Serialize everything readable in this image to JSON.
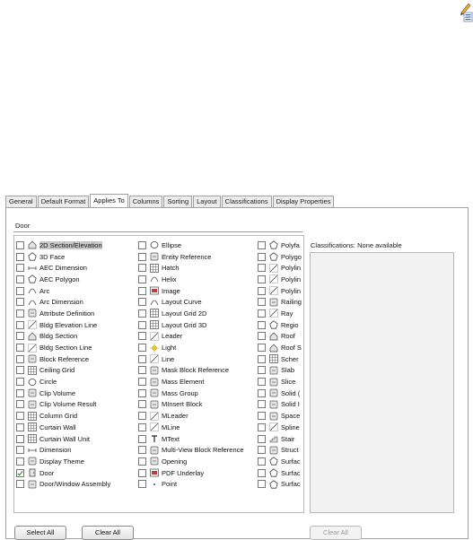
{
  "tabs": [
    {
      "label": "General"
    },
    {
      "label": "Default Format"
    },
    {
      "label": "Applies To",
      "active": true
    },
    {
      "label": "Columns"
    },
    {
      "label": "Sorting"
    },
    {
      "label": "Layout"
    },
    {
      "label": "Classifications"
    },
    {
      "label": "Display Properties"
    }
  ],
  "filter": {
    "value": "Door"
  },
  "classifications": {
    "label": "Classifications: None available"
  },
  "buttons": {
    "select_all": "Select All",
    "clear_all": "Clear All",
    "clear_all_right": "Clear All"
  },
  "columns": [
    [
      {
        "label": "2D Section/Elevation",
        "icon": "section-elevation-icon",
        "selected": true
      },
      {
        "label": "3D Face",
        "icon": "face-icon"
      },
      {
        "label": "AEC Dimension",
        "icon": "dimension-icon"
      },
      {
        "label": "AEC Polygon",
        "icon": "polygon-icon"
      },
      {
        "label": "Arc",
        "icon": "arc-icon"
      },
      {
        "label": "Arc Dimension",
        "icon": "arc-dimension-icon"
      },
      {
        "label": "Attribute Definition",
        "icon": "attribute-icon"
      },
      {
        "label": "Bldg Elevation Line",
        "icon": "elevation-line-icon"
      },
      {
        "label": "Bldg Section",
        "icon": "bldg-section-icon"
      },
      {
        "label": "Bldg Section Line",
        "icon": "section-line-icon"
      },
      {
        "label": "Block Reference",
        "icon": "block-icon"
      },
      {
        "label": "Ceiling Grid",
        "icon": "ceiling-grid-icon"
      },
      {
        "label": "Circle",
        "icon": "circle-icon"
      },
      {
        "label": "Clip Volume",
        "icon": "clip-volume-icon"
      },
      {
        "label": "Clip Volume Result",
        "icon": "clip-result-icon"
      },
      {
        "label": "Column Grid",
        "icon": "column-grid-icon"
      },
      {
        "label": "Curtain Wall",
        "icon": "curtain-wall-icon"
      },
      {
        "label": "Curtain Wall Unit",
        "icon": "curtain-unit-icon"
      },
      {
        "label": "Dimension",
        "icon": "dimension-icon"
      },
      {
        "label": "Display Theme",
        "icon": "theme-icon"
      },
      {
        "label": "Door",
        "icon": "door-icon",
        "checked": true
      },
      {
        "label": "Door/Window Assembly",
        "icon": "assembly-icon"
      }
    ],
    [
      {
        "label": "Ellipse",
        "icon": "ellipse-icon"
      },
      {
        "label": "Entity Reference",
        "icon": "entity-icon"
      },
      {
        "label": "Hatch",
        "icon": "hatch-icon"
      },
      {
        "label": "Helix",
        "icon": "helix-icon"
      },
      {
        "label": "Image",
        "icon": "image-icon"
      },
      {
        "label": "Layout Curve",
        "icon": "curve-icon"
      },
      {
        "label": "Layout Grid 2D",
        "icon": "grid2d-icon"
      },
      {
        "label": "Layout Grid 3D",
        "icon": "grid3d-icon"
      },
      {
        "label": "Leader",
        "icon": "leader-icon"
      },
      {
        "label": "Light",
        "icon": "light-icon"
      },
      {
        "label": "Line",
        "icon": "line-icon"
      },
      {
        "label": "Mask Block Reference",
        "icon": "mask-block-icon"
      },
      {
        "label": "Mass Element",
        "icon": "mass-element-icon"
      },
      {
        "label": "Mass Group",
        "icon": "mass-group-icon"
      },
      {
        "label": "MInsert Block",
        "icon": "minsert-icon"
      },
      {
        "label": "MLeader",
        "icon": "mleader-icon"
      },
      {
        "label": "MLine",
        "icon": "mline-icon"
      },
      {
        "label": "MText",
        "icon": "mtext-icon"
      },
      {
        "label": "Multi-View Block Reference",
        "icon": "mvblock-icon"
      },
      {
        "label": "Opening",
        "icon": "opening-icon"
      },
      {
        "label": "PDF Underlay",
        "icon": "pdf-icon"
      },
      {
        "label": "Point",
        "icon": "point-icon"
      }
    ],
    [
      {
        "label": "Polyfa",
        "icon": "polyface-icon"
      },
      {
        "label": "Polygo",
        "icon": "polygon-icon"
      },
      {
        "label": "Polylin",
        "icon": "polyline-icon"
      },
      {
        "label": "Polylin",
        "icon": "polyline-icon"
      },
      {
        "label": "Polylin",
        "icon": "polyline-icon"
      },
      {
        "label": "Railing",
        "icon": "railing-icon"
      },
      {
        "label": "Ray",
        "icon": "ray-icon"
      },
      {
        "label": "Regio",
        "icon": "region-icon"
      },
      {
        "label": "Roof",
        "icon": "roof-icon"
      },
      {
        "label": "Roof S",
        "icon": "roof-slab-icon"
      },
      {
        "label": "Scher",
        "icon": "schedule-icon"
      },
      {
        "label": "Slab",
        "icon": "slab-icon"
      },
      {
        "label": "Slice",
        "icon": "slice-icon"
      },
      {
        "label": "Solid (",
        "icon": "solid-icon"
      },
      {
        "label": "Solid I",
        "icon": "solid-icon"
      },
      {
        "label": "Space",
        "icon": "space-icon"
      },
      {
        "label": "Spline",
        "icon": "spline-icon"
      },
      {
        "label": "Stair",
        "icon": "stair-icon"
      },
      {
        "label": "Struct",
        "icon": "structure-icon"
      },
      {
        "label": "Surfac",
        "icon": "surface-icon"
      },
      {
        "label": "Surfac",
        "icon": "surface-icon"
      },
      {
        "label": "Surfac",
        "icon": "surface-icon"
      }
    ]
  ]
}
